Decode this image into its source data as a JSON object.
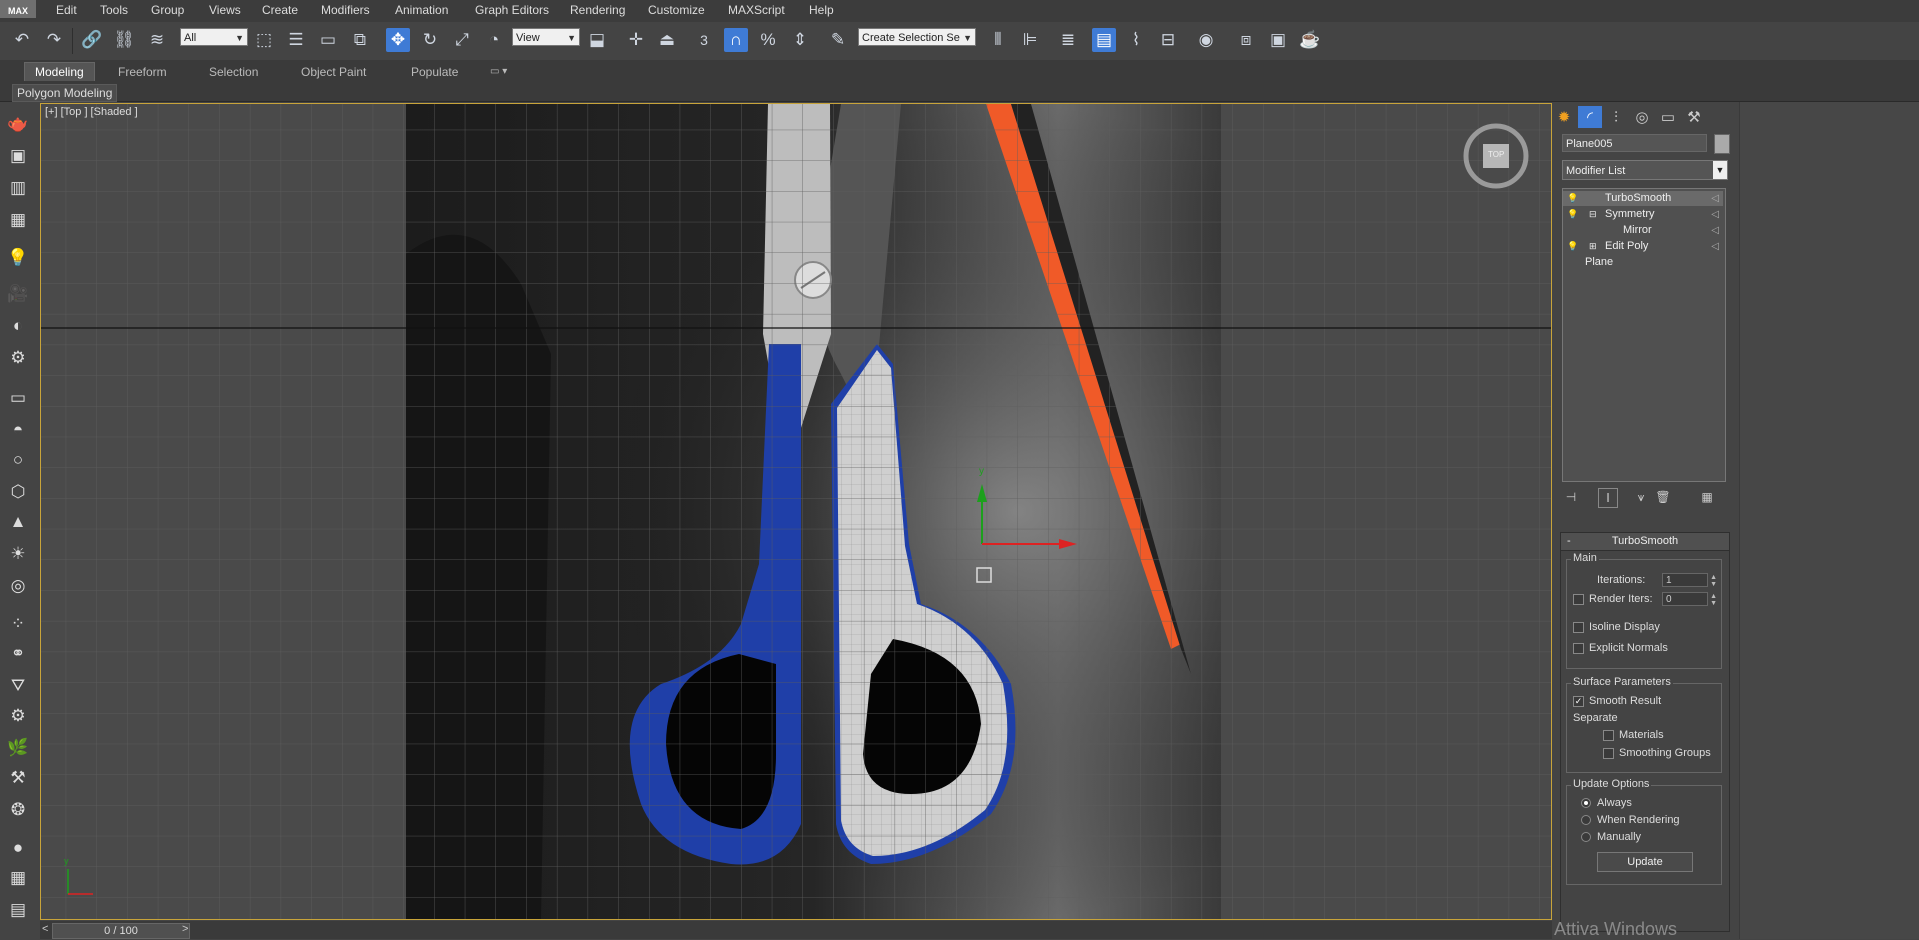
{
  "menubar": {
    "logo": "MAX",
    "items": [
      "Edit",
      "Tools",
      "Group",
      "Views",
      "Create",
      "Modifiers",
      "Animation",
      "Graph Editors",
      "Rendering",
      "Customize",
      "MAXScript",
      "Help"
    ]
  },
  "toolbar": {
    "selection_filter": "All",
    "reference_coord": "View",
    "named_selection_placeholder": "Create Selection Se",
    "snap_label": "3"
  },
  "ribbon": {
    "tabs": [
      "Modeling",
      "Freeform",
      "Selection",
      "Object Paint",
      "Populate"
    ],
    "active_tab": "Modeling",
    "panel_label": "Polygon Modeling"
  },
  "viewport": {
    "label": "[+] [Top ] [Shaded ]",
    "viewcube_label": "TOP",
    "gizmo_y": "y",
    "axis_y": "y",
    "axis_x": "x"
  },
  "timeline": {
    "frame": "0 / 100"
  },
  "command_panel": {
    "object_name": "Plane005",
    "modifier_list": "Modifier List",
    "stack": [
      {
        "label": "TurboSmooth"
      },
      {
        "label": "Symmetry"
      },
      {
        "label": "Mirror"
      },
      {
        "label": "Edit Poly"
      },
      {
        "label": "Plane"
      }
    ],
    "rollout": {
      "title": "TurboSmooth",
      "main_group": "Main",
      "iterations_label": "Iterations:",
      "iterations_value": "1",
      "render_iters_label": "Render Iters:",
      "render_iters_value": "0",
      "isoline_display": "Isoline Display",
      "explicit_normals": "Explicit Normals",
      "surface_group": "Surface Parameters",
      "smooth_result": "Smooth Result",
      "separate_label": "Separate",
      "materials": "Materials",
      "smoothing_groups": "Smoothing Groups",
      "update_group": "Update Options",
      "always": "Always",
      "when_rendering": "When Rendering",
      "manually": "Manually",
      "update_button": "Update"
    }
  },
  "watermark": "Attiva Windows",
  "colors": {
    "accent": "#3f7bd5",
    "viewport_border": "#c8a43a",
    "handle_blue": "#1f3fa8",
    "blade_orange": "#f05a28"
  }
}
